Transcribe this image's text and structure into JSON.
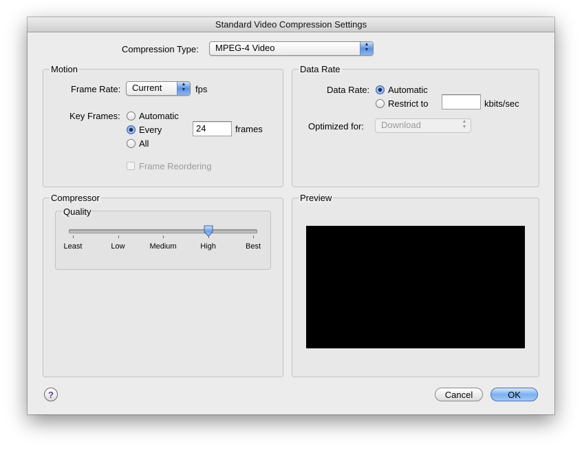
{
  "window": {
    "title": "Standard Video Compression Settings"
  },
  "compression": {
    "label": "Compression Type:",
    "value": "MPEG-4 Video"
  },
  "motion": {
    "title": "Motion",
    "frame_rate_label": "Frame Rate:",
    "frame_rate_value": "Current",
    "frame_rate_unit": "fps",
    "key_frames_label": "Key Frames:",
    "key_frames_options": [
      {
        "label": "Automatic",
        "selected": false
      },
      {
        "label": "Every",
        "selected": true
      },
      {
        "label": "All",
        "selected": false
      }
    ],
    "key_frames_every_value": "24",
    "key_frames_unit": "frames",
    "frame_reordering_label": "Frame Reordering",
    "frame_reordering_checked": false
  },
  "data_rate": {
    "title": "Data Rate",
    "label": "Data Rate:",
    "options": [
      {
        "label": "Automatic",
        "selected": true
      },
      {
        "label": "Restrict to",
        "selected": false
      }
    ],
    "restrict_value": "",
    "unit": "kbits/sec",
    "optimized_label": "Optimized for:",
    "optimized_value": "Download"
  },
  "compressor": {
    "title": "Compressor",
    "quality": {
      "title": "Quality",
      "levels": [
        "Least",
        "Low",
        "Medium",
        "High",
        "Best"
      ],
      "selected": "High",
      "selected_fraction": 0.75
    }
  },
  "preview": {
    "title": "Preview"
  },
  "buttons": {
    "cancel": "Cancel",
    "ok": "OK",
    "help": "?"
  },
  "colors": {
    "accent": "#5f95e1",
    "preview_background": "#000000"
  }
}
